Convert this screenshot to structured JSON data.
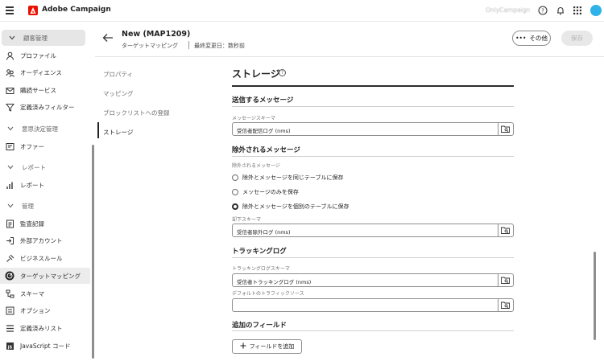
{
  "app": {
    "title": "Adobe Campaign",
    "org": "OnlyCampaign"
  },
  "sidebar": {
    "items": [
      {
        "label": "顧客管理",
        "type": "section"
      },
      {
        "label": "プロファイル"
      },
      {
        "label": "オーディエンス"
      },
      {
        "label": "購読サービス"
      },
      {
        "label": "定義済みフィルター"
      },
      {
        "label": "意思決定管理",
        "type": "section"
      },
      {
        "label": "オファー"
      },
      {
        "label": "レポート",
        "type": "section"
      },
      {
        "label": "レポート"
      },
      {
        "label": "管理",
        "type": "section"
      },
      {
        "label": "監査記録"
      },
      {
        "label": "外部アカウント"
      },
      {
        "label": "ビジネスルール"
      },
      {
        "label": "ターゲットマッピング"
      },
      {
        "label": "スキーマ"
      },
      {
        "label": "オプション"
      },
      {
        "label": "定義済みリスト"
      },
      {
        "label": "JavaScript コード"
      }
    ]
  },
  "header": {
    "title": "New (MAP1209)",
    "subtitle": "ターゲットマッピング",
    "modified": "最終変更日：数秒前",
    "more_label": "その他",
    "save_label": "保存"
  },
  "tabs": [
    "プロパティ",
    "マッピング",
    "ブロックリストへの登録",
    "ストレージ"
  ],
  "content": {
    "title": "ストレージ",
    "help": "?",
    "sent": {
      "heading": "送信するメッセージ",
      "schema_label": "メッセージスキーマ",
      "schema_value": "受信者配信ログ (nms)"
    },
    "excluded": {
      "heading": "除外されるメッセージ",
      "label": "除外されるメッセージ",
      "options": [
        "除外とメッセージを同じテーブルに保存",
        "メッセージのみを保存",
        "除外とメッセージを個別のテーブルに保存"
      ],
      "selected_index": 2,
      "schema_label": "却下スキーマ",
      "schema_value": "受信者除外ログ (nms)"
    },
    "tracking": {
      "heading": "トラッキングログ",
      "schema_label": "トラッキングログスキーマ",
      "schema_value": "受信者トラッキングログ (nms)",
      "traffic_label": "デフォルトのトラフィックソース",
      "traffic_value": ""
    },
    "additional": {
      "heading": "追加のフィールド",
      "add_label": "フィールドを追加"
    }
  }
}
